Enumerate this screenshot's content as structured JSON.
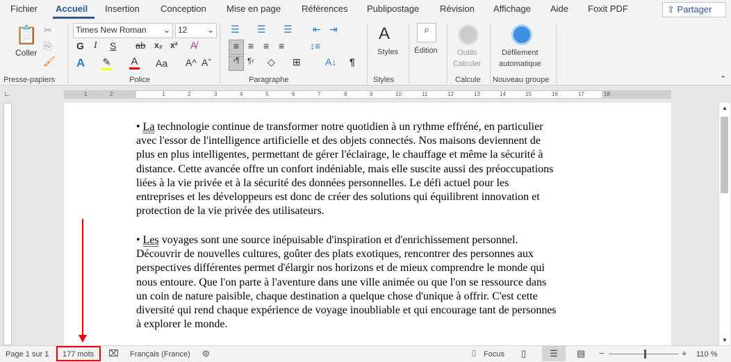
{
  "tabs": [
    "Fichier",
    "Accueil",
    "Insertion",
    "Conception",
    "Mise en page",
    "Références",
    "Publipostage",
    "Révision",
    "Affichage",
    "Aide",
    "Foxit PDF"
  ],
  "share_label": "Partager",
  "ribbon": {
    "clipboard": {
      "paste": "Coller",
      "group": "Presse-papiers"
    },
    "font": {
      "name": "Times New Roman",
      "size": "12",
      "bold": "G",
      "italic": "I",
      "underline": "S",
      "strike": "ab",
      "sub": "x₂",
      "sup": "x²",
      "case": "Aa",
      "grow": "A^",
      "shrink": "Aˇ",
      "group": "Police",
      "highlight_color": "#ffff00",
      "font_color": "#ff0000"
    },
    "paragraph": {
      "group": "Paragraphe"
    },
    "styles": {
      "label": "Styles",
      "group": "Styles"
    },
    "editing": {
      "label": "Édition"
    },
    "calc": {
      "label1": "Outils",
      "label2": "Calculer",
      "group": "Calcule"
    },
    "scroll": {
      "label1": "Défilement",
      "label2": "automatique",
      "group": "Nouveau groupe"
    }
  },
  "ruler_numbers": [
    "1",
    "2",
    "1",
    "2",
    "3",
    "4",
    "5",
    "6",
    "7",
    "8",
    "9",
    "10",
    "11",
    "12",
    "13",
    "14",
    "15",
    "16",
    "17",
    "18"
  ],
  "document": {
    "paragraphs": [
      {
        "first_word": "La",
        "lines": [
          " technologie continue de transformer notre quotidien à un rythme effréné, en particulier",
          "avec l'essor de l'intelligence artificielle et des objets connectés. Nos maisons deviennent de",
          "plus en plus intelligentes, permettant de gérer l'éclairage, le chauffage et même la sécurité à",
          "distance. Cette avancée offre un confort indéniable, mais elle suscite aussi des préoccupations",
          "liées à la vie privée et à la sécurité des données personnelles. Le défi actuel pour les",
          "entreprises et les développeurs est donc de créer des solutions qui équilibrent innovation et",
          "protection de la vie privée des utilisateurs."
        ]
      },
      {
        "first_word": "Les",
        "lines": [
          " voyages sont une source inépuisable d'inspiration et d'enrichissement personnel.",
          "Découvrir de nouvelles cultures, goûter des plats exotiques, rencontrer des personnes aux",
          "perspectives différentes permet d'élargir nos horizons et de mieux comprendre le monde qui",
          "nous entoure. Que l'on parte à l'aventure dans une ville animée ou que l'on se ressource dans",
          "un coin de nature paisible, chaque destination a quelque chose d'unique à offrir. C'est cette",
          "diversité qui rend chaque expérience de voyage inoubliable et qui encourage tant de personnes",
          "à explorer le monde."
        ]
      }
    ]
  },
  "status": {
    "page": "Page 1 sur 1",
    "words": "177 mots",
    "language": "Français (France)",
    "focus": "Focus",
    "zoom": "110 %",
    "zoom_minus": "−",
    "zoom_plus": "+",
    "zoom_level_percent": 110
  },
  "annotation_color": "#e00000"
}
